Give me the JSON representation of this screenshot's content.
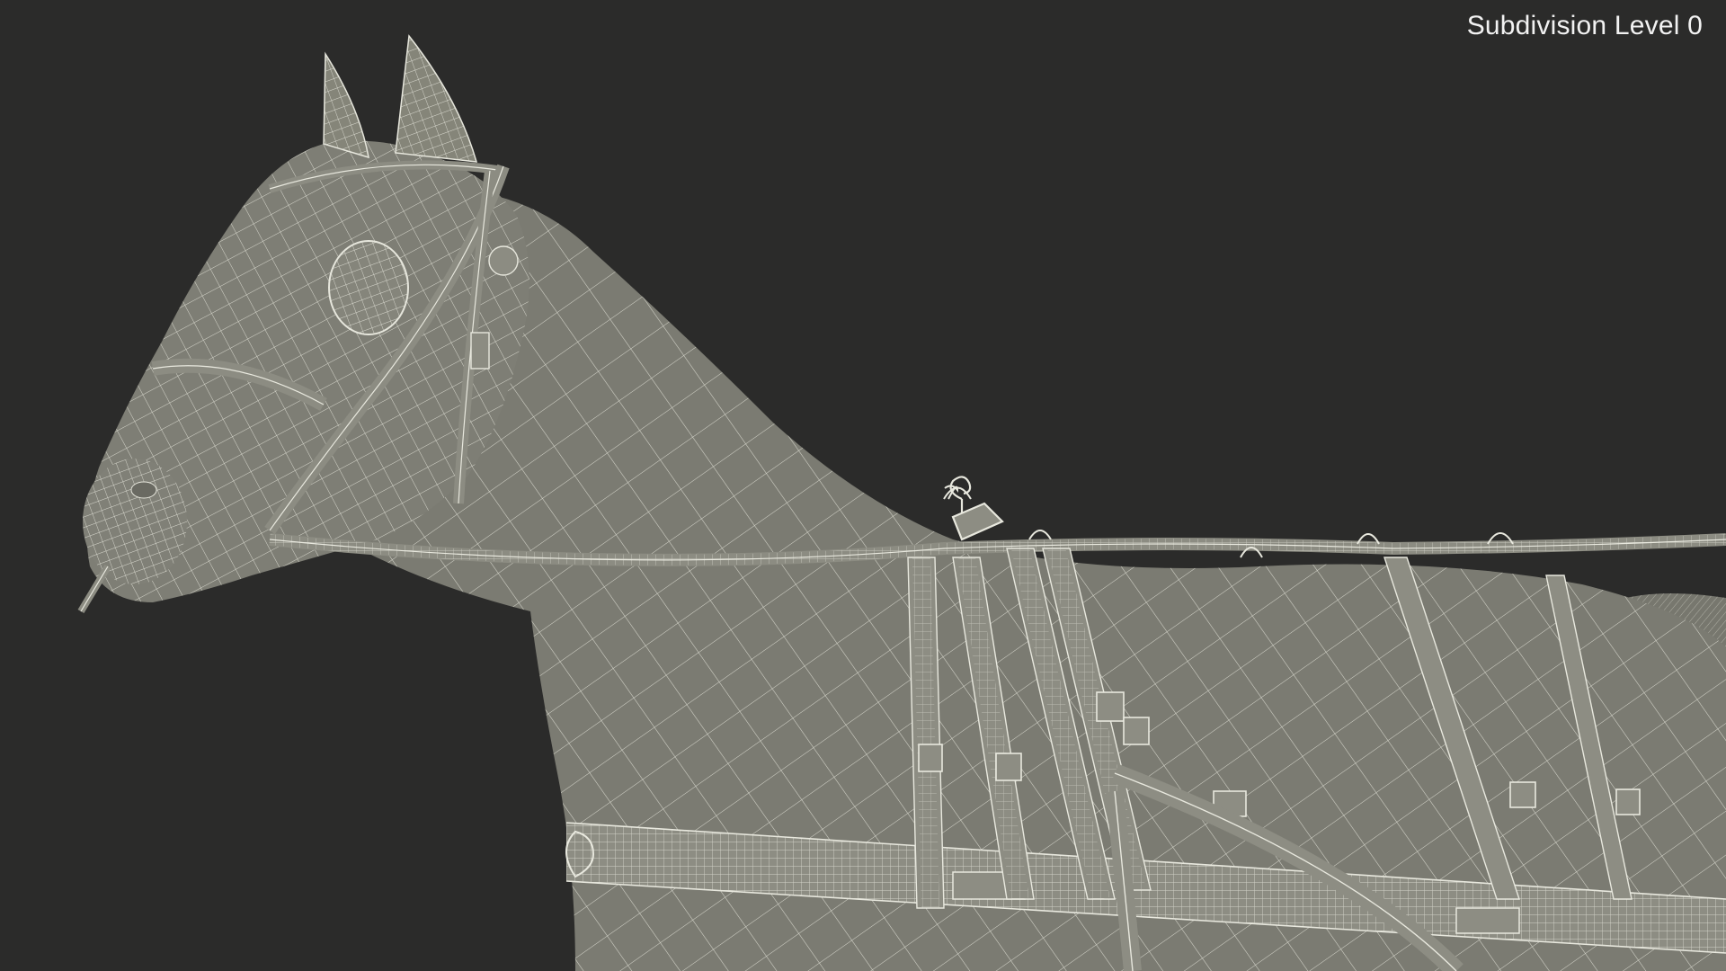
{
  "viewport": {
    "overlay_label": "Subdivision Level 0",
    "subject": "horse-head-with-harness-wireframe",
    "render_mode": "shaded-wireframe"
  },
  "colors": {
    "background": "#2b2b2a",
    "mesh_fill": "#7a7a70",
    "mesh_shadow": "#5e5e56",
    "wire": "#e8e8de",
    "strap_fill": "#8a8a80",
    "label": "#f2f2f2"
  }
}
